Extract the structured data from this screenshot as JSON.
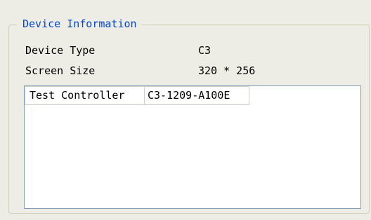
{
  "group": {
    "title": "Device Information"
  },
  "fields": [
    {
      "label": "Device Type",
      "value": "C3"
    },
    {
      "label": "Screen Size",
      "value": "320 * 256"
    }
  ],
  "controllers": [
    {
      "name": "Test Controller",
      "id": "C3-1209-A100E"
    }
  ]
}
